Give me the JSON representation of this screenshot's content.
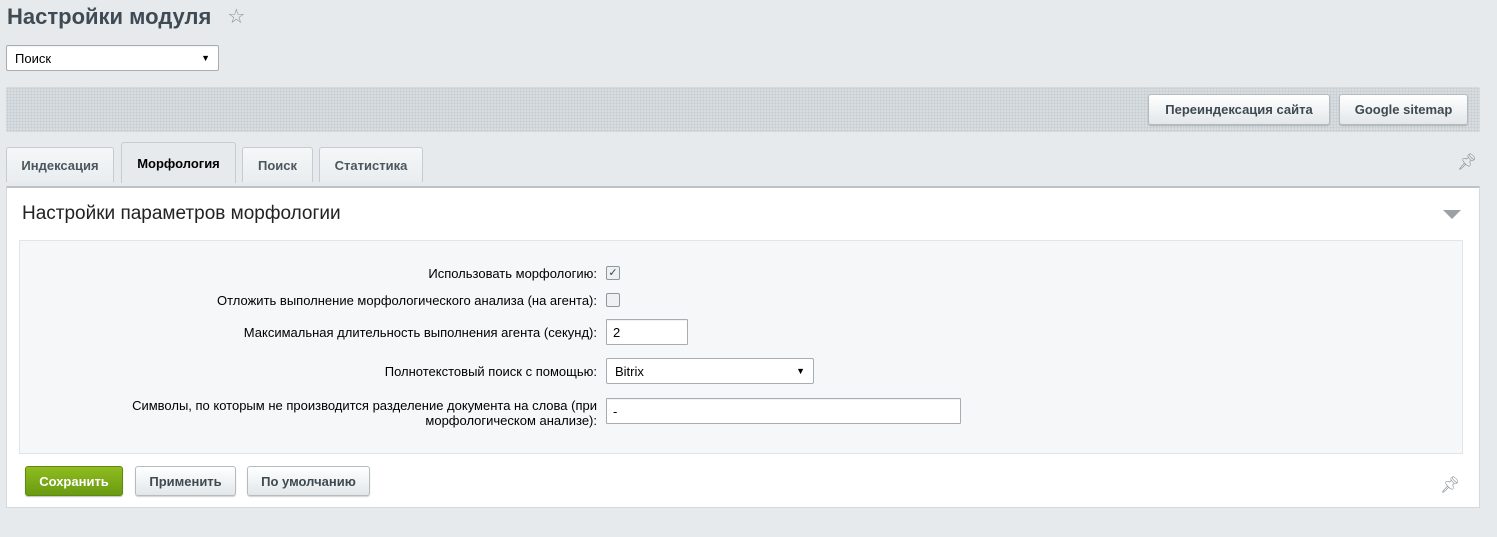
{
  "header": {
    "title": "Настройки модуля",
    "star_icon": "star-icon"
  },
  "module_select": {
    "selected": "Поиск"
  },
  "toolbar": {
    "reindex_label": "Переиндексация сайта",
    "sitemap_label": "Google sitemap"
  },
  "tabs": [
    {
      "label": "Индексация",
      "active": false
    },
    {
      "label": "Морфология",
      "active": true
    },
    {
      "label": "Поиск",
      "active": false
    },
    {
      "label": "Статистика",
      "active": false
    }
  ],
  "section": {
    "title": "Настройки параметров морфологии"
  },
  "form": {
    "use_morphology": {
      "label": "Использовать морфологию:",
      "checked": true
    },
    "defer_analysis": {
      "label": "Отложить выполнение морфологического анализа (на агента):",
      "checked": false
    },
    "agent_duration": {
      "label": "Максимальная длительность выполнения агента (секунд):",
      "value": "2"
    },
    "fulltext_search": {
      "label": "Полнотекстовый поиск с помощью:",
      "selected": "Bitrix"
    },
    "word_chars": {
      "label_line1": "Символы, по которым не производится разделение документа на слова (при",
      "label_line2": "морфологическом анализе):",
      "value": "-"
    }
  },
  "footer": {
    "save_label": "Сохранить",
    "apply_label": "Применить",
    "default_label": "По умолчанию"
  },
  "colors": {
    "save_button": "#7aa91a",
    "background": "#e7eaec"
  }
}
